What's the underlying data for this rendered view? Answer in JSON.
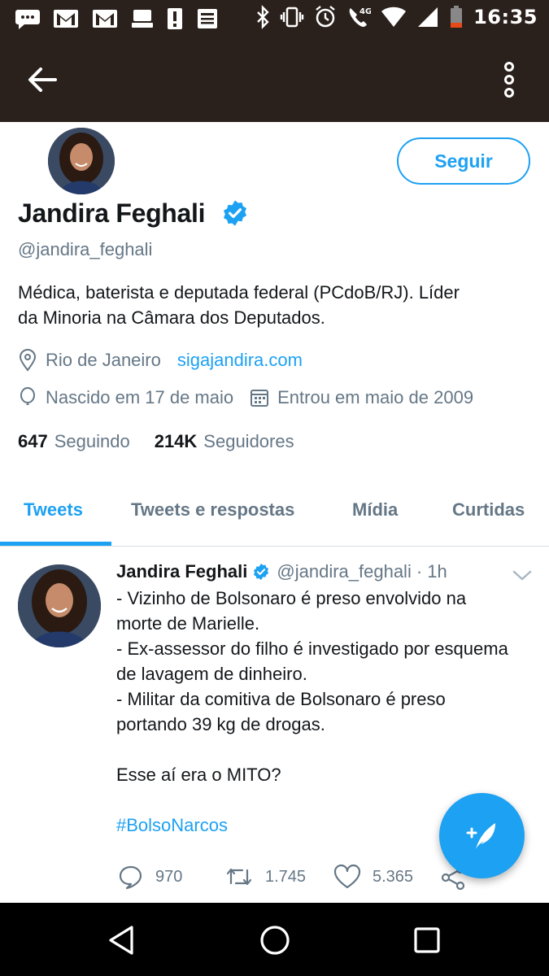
{
  "status_bar": {
    "time": "16:35",
    "network": "4G",
    "left_icons": [
      "chat-icon",
      "gmail-icon",
      "gmail-icon",
      "storage-icon",
      "alert-icon",
      "news-icon"
    ],
    "right_icons": [
      "bluetooth-icon",
      "vibrate-icon",
      "alarm-icon",
      "wifi-call-icon",
      "wifi-icon",
      "signal-icon",
      "battery-icon"
    ]
  },
  "app_bar": {
    "back_icon": "arrow-left-icon",
    "menu_icon": "more-vertical-icon",
    "background": "#2b211c"
  },
  "profile": {
    "follow_label": "Seguir",
    "name": "Jandira Feghali",
    "verified": true,
    "handle": "@jandira_feghali",
    "bio_lines": [
      "Médica, baterista e deputada federal (PCdoB/RJ). Líder",
      "da Minoria na Câmara dos Deputados."
    ],
    "location": "Rio de Janeiro",
    "website": "sigajandira.com",
    "birthday": "Nascido em 17 de maio",
    "joined": "Entrou em maio de 2009",
    "following_count": "647",
    "following_label": "Seguindo",
    "followers_count": "214K",
    "followers_label": "Seguidores"
  },
  "tabs": [
    {
      "label": "Tweets",
      "active": true
    },
    {
      "label": "Tweets e respostas",
      "active": false
    },
    {
      "label": "Mídia",
      "active": false
    },
    {
      "label": "Curtidas",
      "active": false
    }
  ],
  "tweet": {
    "author": "Jandira Feghali",
    "handle": "@jandira_feghali",
    "time": "· 1h",
    "lines": [
      "- Vizinho de Bolsonaro é preso envolvido na",
      "morte de Marielle.",
      "- Ex-assessor do filho é investigado por esquema",
      "de lavagem de dinheiro.",
      "- Militar da comitiva de Bolsonaro é preso",
      "portando 39 kg de drogas.",
      "",
      "Esse aí era o MITO?",
      ""
    ],
    "hashtag": "#BolsoNarcos",
    "replies": "970",
    "retweets": "1.745",
    "likes": "5.365"
  },
  "fab": {
    "icon": "compose-tweet-icon"
  },
  "colors": {
    "accent": "#1da1f2",
    "secondary_text": "#657786",
    "primary_text": "#14171a"
  }
}
